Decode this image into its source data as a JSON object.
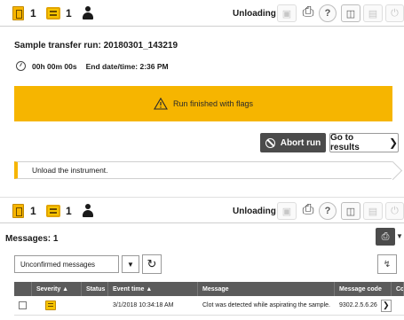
{
  "top_bar": {
    "sample_rack_count": "1",
    "message_count": "1",
    "instrument_state": "Unloading"
  },
  "run": {
    "title": "Sample transfer run: 20180301_143219",
    "elapsed": "00h 00m 00s",
    "end_label": "End date/time: 2:36 PM",
    "flag_message": "Run finished with flags",
    "abort_label": "Abort run",
    "results_label": "Go to results",
    "unload_instruction": "Unload the instrument."
  },
  "messages": {
    "header": "Messages: 1",
    "filter_value": "Unconfirmed messages",
    "columns": {
      "severity": "Severity ▲",
      "status": "Status",
      "event_time": "Event time ▲",
      "message": "Message",
      "code": "Message code",
      "extra": "Co"
    },
    "rows": [
      {
        "event_time": "3/1/2018 10:34:18 AM",
        "message": "Clot was detected while aspirating the sample.",
        "code": "9302.2.5.6.26"
      }
    ]
  },
  "colors": {
    "accent": "#f6b500",
    "dark_button": "#4b4b4b",
    "table_header": "#5b5b5b"
  },
  "icons": [
    "rack-icon",
    "message-icon",
    "user-icon",
    "instrument-icon",
    "print-icon",
    "help-icon",
    "camera-icon",
    "cabinet-icon",
    "power-icon",
    "timer-icon",
    "warning-icon",
    "ban-icon",
    "refresh-icon",
    "expand-icon"
  ]
}
